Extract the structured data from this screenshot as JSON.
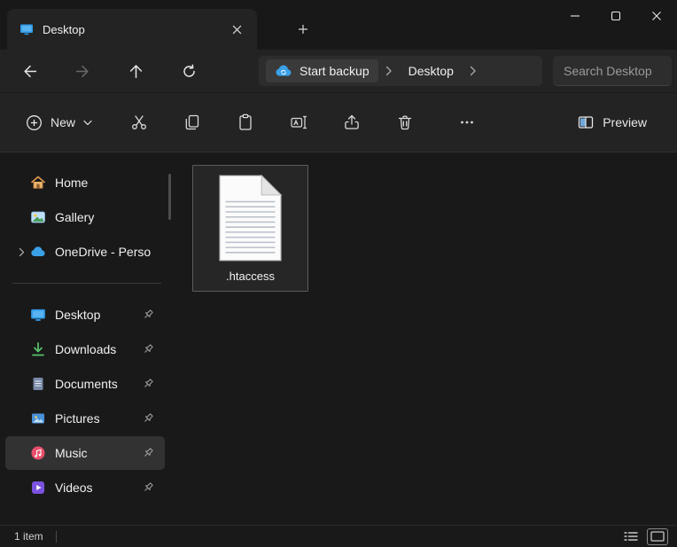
{
  "window": {
    "tab_title": "Desktop"
  },
  "navbar": {
    "breadcrumb": {
      "start_backup_label": "Start backup",
      "location": "Desktop"
    },
    "search_placeholder": "Search Desktop"
  },
  "toolbar": {
    "new_label": "New",
    "preview_label": "Preview"
  },
  "sidebar": {
    "items": [
      {
        "label": "Home",
        "icon": "home-icon"
      },
      {
        "label": "Gallery",
        "icon": "gallery-icon"
      },
      {
        "label": "OneDrive - Perso",
        "icon": "onedrive-icon",
        "expandable": true
      }
    ],
    "pinned": [
      {
        "label": "Desktop",
        "icon": "desktop-icon",
        "pinned": true
      },
      {
        "label": "Downloads",
        "icon": "downloads-icon",
        "pinned": true
      },
      {
        "label": "Documents",
        "icon": "documents-icon",
        "pinned": true
      },
      {
        "label": "Pictures",
        "icon": "pictures-icon",
        "pinned": true
      },
      {
        "label": "Music",
        "icon": "music-icon",
        "pinned": true,
        "selected": true
      },
      {
        "label": "Videos",
        "icon": "videos-icon",
        "pinned": true
      }
    ]
  },
  "content": {
    "files": [
      {
        "name": ".htaccess",
        "icon": "text-file-icon",
        "selected": true
      }
    ]
  },
  "statusbar": {
    "item_count": "1 item"
  },
  "icons": {
    "titlebar": [
      "desktop-folder-icon",
      "tab-close-icon",
      "new-tab-plus-icon",
      "minimize-icon",
      "maximize-icon",
      "close-icon"
    ],
    "navbar": [
      "back-arrow-icon",
      "forward-arrow-icon",
      "up-arrow-icon",
      "refresh-icon",
      "cloud-sync-icon",
      "chevron-right-icon"
    ],
    "toolbar": [
      "plus-circle-icon",
      "chevron-down-icon",
      "cut-icon",
      "copy-icon",
      "paste-icon",
      "rename-icon",
      "share-icon",
      "delete-icon",
      "more-icon",
      "preview-pane-icon"
    ],
    "statusbar": [
      "details-view-icon",
      "thumbnail-view-icon"
    ],
    "sidebar": [
      "pin-icon",
      "chevron-expand-icon"
    ]
  },
  "colors": {
    "accent_blue": "#2f9ae8",
    "onedrive_blue": "#3aa0e8",
    "downloads_green": "#58c06a",
    "documents_blue_gray": "#7a8aa8",
    "pictures_blue": "#4a90d9",
    "music_red": "#e84f6a",
    "videos_purple": "#7a52e0",
    "home_orange": "#e09a50"
  }
}
